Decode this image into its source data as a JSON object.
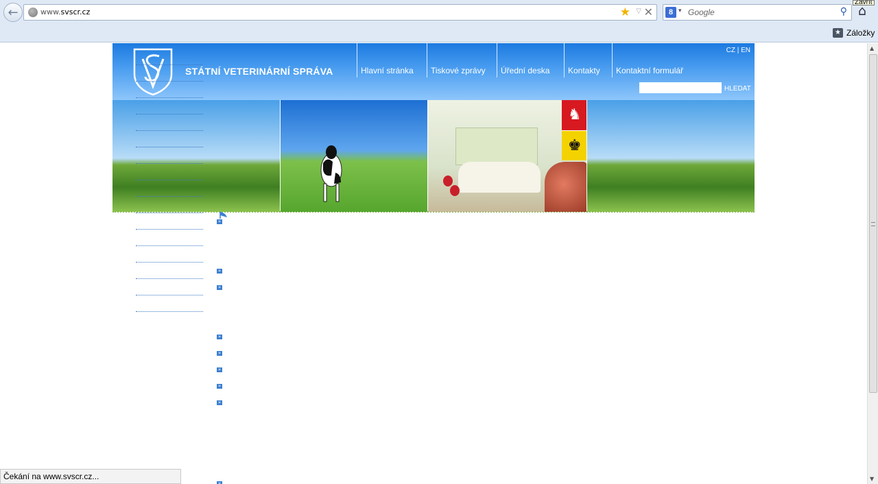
{
  "browser": {
    "url_prefix": "www.",
    "url_domain": "svscr.cz",
    "search_engine_badge": "8",
    "search_placeholder": "Google",
    "tooltip": "Zavřít",
    "bookmarks_label": "Záložky",
    "status_text": "Čekání na www.svscr.cz..."
  },
  "site": {
    "title": "STÁTNÍ VETERINÁRNÍ SPRÁVA",
    "nav": [
      "Hlavní stránka",
      "Tiskové zprávy",
      "Úřední deska",
      "Kontakty",
      "Kontaktní formulář"
    ],
    "lang": "CZ | EN",
    "search_button": "HLEDAT"
  },
  "left_menu_count": 16,
  "colors": {
    "header_top": "#1c7ae0",
    "link_blue": "#3a77c4"
  },
  "icons": [
    "back-icon",
    "globe-icon",
    "star-icon",
    "stop-icon",
    "google-icon",
    "magnifier-icon",
    "home-icon",
    "bookmarks-star-icon",
    "shield-logo-icon",
    "bullet-arrow-icon"
  ]
}
